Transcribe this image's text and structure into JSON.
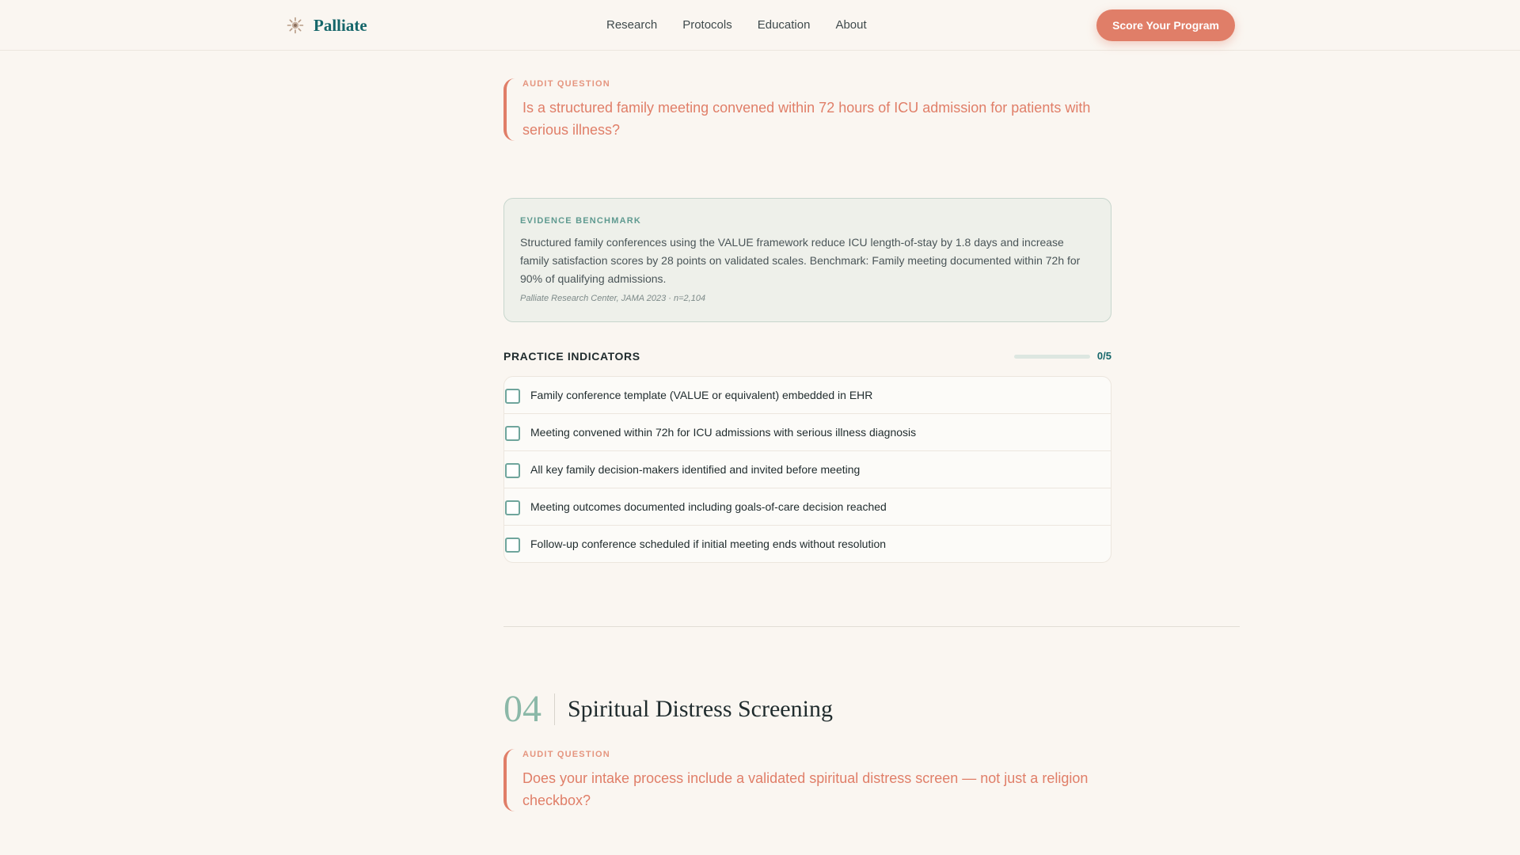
{
  "header": {
    "brand": "Palliate",
    "nav": [
      "Research",
      "Protocols",
      "Education",
      "About"
    ],
    "cta_label": "Score Your Program"
  },
  "section3": {
    "audit_label": "AUDIT QUESTION",
    "audit_question": "Is a structured family meeting convened within 72 hours of ICU admission for patients with serious illness?",
    "benchmark_label": "EVIDENCE BENCHMARK",
    "benchmark_text": "Structured family conferences using the VALUE framework reduce ICU length-of-stay by 1.8 days and increase family satisfaction scores by 28 points on validated scales. Benchmark: Family meeting documented within 72h for 90% of qualifying admissions.",
    "benchmark_citation": "Palliate Research Center, JAMA 2023 · n=2,104",
    "indicators_title": "PRACTICE INDICATORS",
    "indicators_count": "0/5",
    "indicators_progress": 0,
    "indicators": [
      "Family conference template (VALUE or equivalent) embedded in EHR",
      "Meeting convened within 72h for ICU admissions with serious illness diagnosis",
      "All key family decision-makers identified and invited before meeting",
      "Meeting outcomes documented including goals-of-care decision reached",
      "Follow-up conference scheduled if initial meeting ends without resolution"
    ]
  },
  "section4": {
    "number": "04",
    "title": "Spiritual Distress Screening",
    "audit_label": "AUDIT QUESTION",
    "audit_question": "Does your intake process include a validated spiritual distress screen — not just a religion checkbox?"
  },
  "colors": {
    "accent": "#e07e68",
    "brand": "#15666a",
    "sage": "#8bb8a8",
    "background": "#faf6f1"
  }
}
